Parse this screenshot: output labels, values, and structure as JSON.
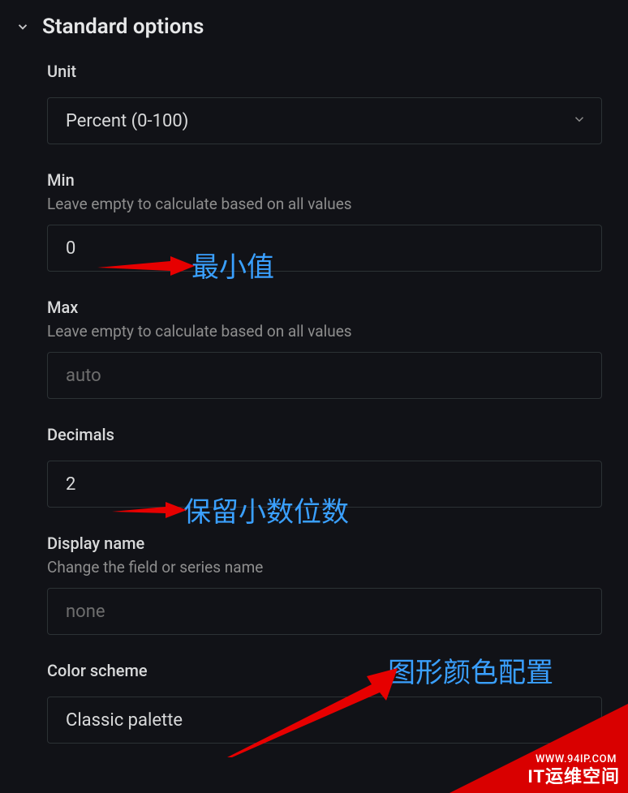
{
  "section": {
    "title": "Standard options"
  },
  "unit": {
    "label": "Unit",
    "value": "Percent (0-100)"
  },
  "min": {
    "label": "Min",
    "desc": "Leave empty to calculate based on all values",
    "value": "0"
  },
  "max": {
    "label": "Max",
    "desc": "Leave empty to calculate based on all values",
    "placeholder": "auto"
  },
  "decimals": {
    "label": "Decimals",
    "value": "2"
  },
  "displayName": {
    "label": "Display name",
    "desc": "Change the field or series name",
    "placeholder": "none"
  },
  "colorScheme": {
    "label": "Color scheme",
    "value": "Classic palette"
  },
  "annotations": {
    "min": "最小值",
    "decimals": "保留小数位数",
    "colorScheme": "图形颜色配置"
  },
  "watermark": {
    "url": "WWW.94IP.COM",
    "text": "IT运维空间"
  }
}
